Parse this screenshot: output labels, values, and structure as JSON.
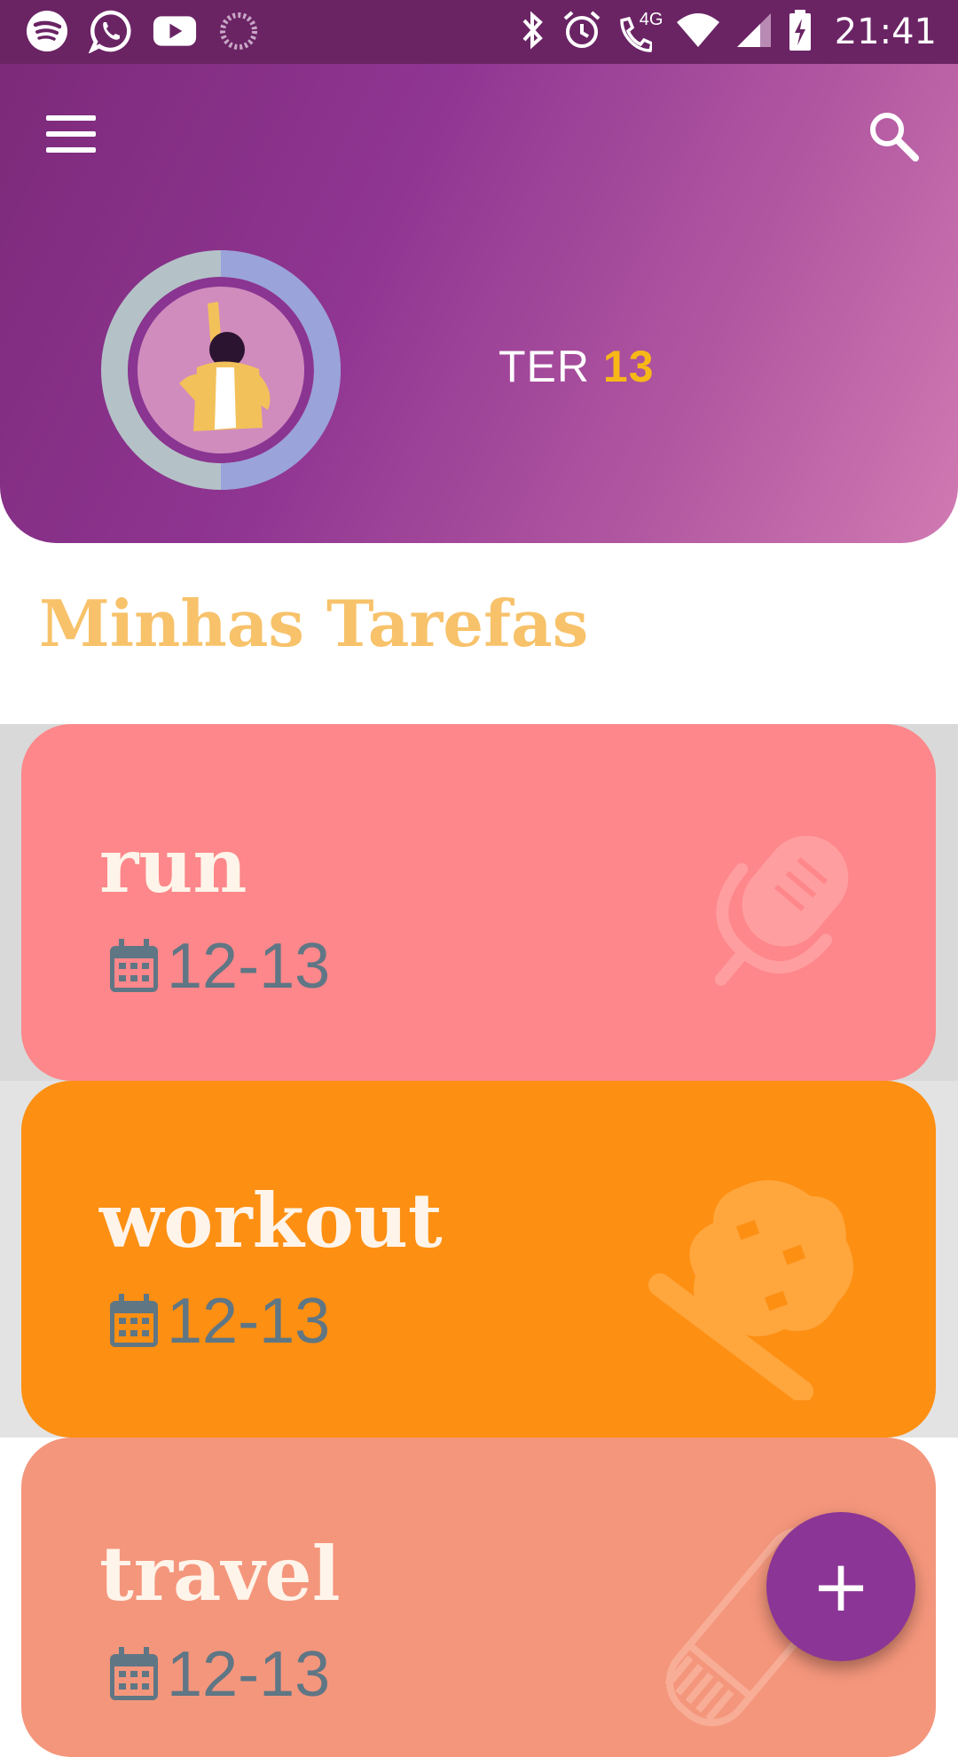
{
  "status_bar": {
    "left_icons": [
      "spotify-icon",
      "whatsapp-icon",
      "youtube-icon",
      "loading-icon"
    ],
    "right_icons": [
      "bluetooth-icon",
      "alarm-icon",
      "volte-call-icon",
      "wifi-icon",
      "signal-icon",
      "battery-charging-icon"
    ],
    "network_label": "4G",
    "time": "21:41"
  },
  "header": {
    "menu_icon": "hamburger-menu-icon",
    "search_icon": "search-icon",
    "day_label": "TER",
    "day_number": "13",
    "colors": {
      "gradient_start": "#7d2a7a",
      "gradient_end": "#d07ab2",
      "accent": "#f7b817"
    }
  },
  "section_title": "Minhas Tarefas",
  "tasks": [
    {
      "title": "run",
      "date": "12-13",
      "icon": "microphone-icon",
      "color": "#fd878a"
    },
    {
      "title": "workout",
      "date": "12-13",
      "icon": "cupcake-icon",
      "color": "#fd8f12"
    },
    {
      "title": "travel",
      "date": "12-13",
      "icon": "ruler-icon",
      "color": "#f4967c"
    }
  ],
  "fab": {
    "label": "+",
    "icon": "add-icon",
    "color": "#8b3596"
  }
}
